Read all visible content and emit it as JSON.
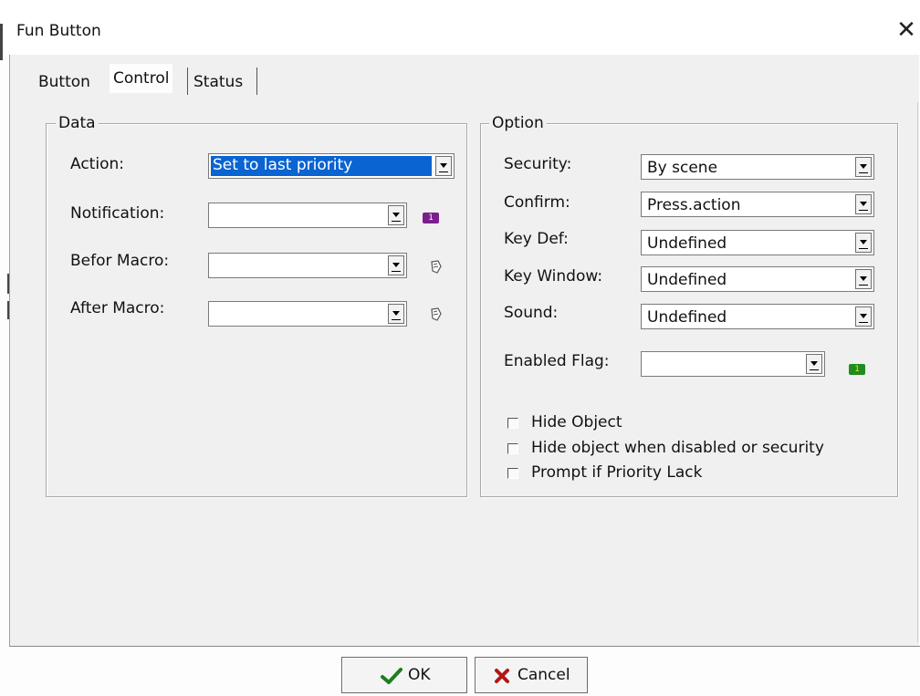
{
  "window": {
    "title": "Fun Button",
    "close_glyph": "✕"
  },
  "tabs": [
    {
      "label": "Button"
    },
    {
      "label": "Control",
      "active": true
    },
    {
      "label": "Status"
    }
  ],
  "data_group": {
    "title": "Data",
    "action": {
      "label": "Action:",
      "value": "Set to last priority"
    },
    "notification": {
      "label": "Notification:",
      "value": "",
      "flag_badge": "1",
      "flag_color": "#7a1f8c"
    },
    "before_macro": {
      "label": "Befor Macro:",
      "value": "",
      "icon": "macro-icon"
    },
    "after_macro": {
      "label": "After Macro:",
      "value": "",
      "icon": "macro-icon"
    }
  },
  "option_group": {
    "title": "Option",
    "security": {
      "label": "Security:",
      "value": "By scene"
    },
    "confirm": {
      "label": "Confirm:",
      "value": "Press.action"
    },
    "key_def": {
      "label": "Key Def:",
      "value": "Undefined"
    },
    "key_window": {
      "label": "Key Window:",
      "value": "Undefined"
    },
    "sound": {
      "label": "Sound:",
      "value": "Undefined"
    },
    "enabled_flag": {
      "label": "Enabled Flag:",
      "value": "",
      "flag_badge": "1",
      "flag_color": "#1f8c1f"
    },
    "checkboxes": [
      {
        "label": "Hide Object",
        "checked": false
      },
      {
        "label": "Hide object when disabled or security",
        "checked": false
      },
      {
        "label": "Prompt if Priority Lack",
        "checked": false
      }
    ]
  },
  "buttons": {
    "ok": {
      "label": "OK",
      "icon": "check-icon",
      "icon_color": "#1e7d1e"
    },
    "cancel": {
      "label": "Cancel",
      "icon": "x-icon",
      "icon_color": "#b01818"
    }
  },
  "colors": {
    "selection": "#0a64d2",
    "dialog_bg": "#f0f0f0"
  }
}
